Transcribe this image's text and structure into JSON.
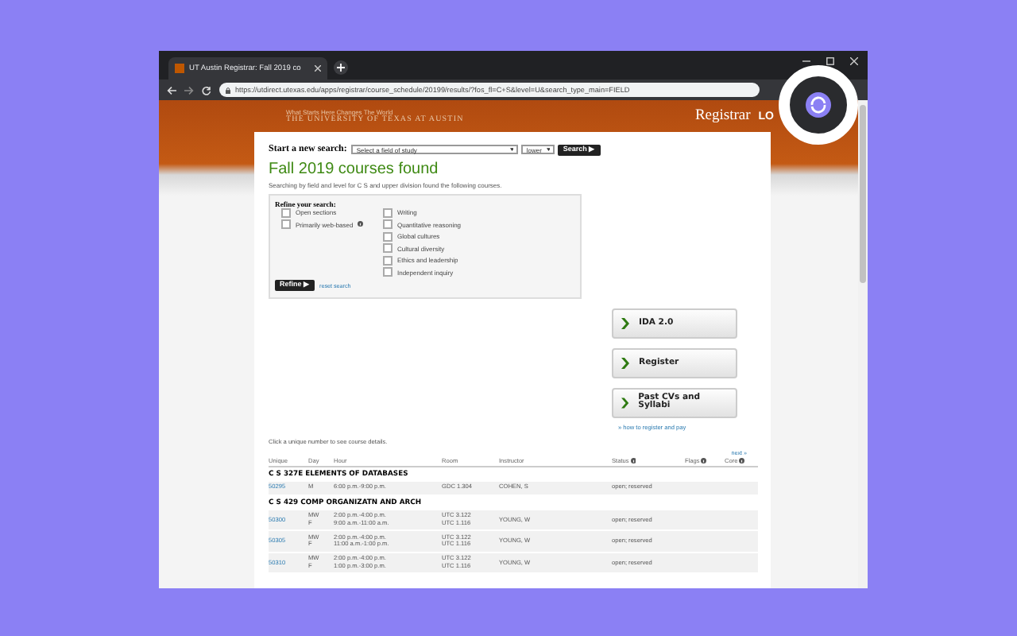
{
  "browser": {
    "tab_title": "UT Austin Registrar: Fall 2019 co",
    "url": "https://utdirect.utexas.edu/apps/registrar/course_schedule/20199/results/?fos_fl=C+S&level=U&search_type_main=FIELD"
  },
  "header": {
    "tagline": "What Starts Here Changes The World",
    "university": "THE UNIVERSITY OF TEXAS AT AUSTIN",
    "registrar": "Registrar",
    "login": "LO"
  },
  "search": {
    "label": "Start a new search:",
    "field": "Select a field of study",
    "level": "lower",
    "button": "Search ▶"
  },
  "heading": "Fall 2019 courses found",
  "summary": "Searching by field and level for C S and upper division found the following courses.",
  "refine": {
    "title": "Refine your search:",
    "left_options": [
      {
        "label": "Open sections",
        "checked": false,
        "info": false
      },
      {
        "label": "Primarily web-based",
        "checked": false,
        "info": true
      }
    ],
    "right_options": [
      {
        "label": "Writing",
        "checked": false
      },
      {
        "label": "Quantitative reasoning",
        "checked": false
      },
      {
        "label": "Global cultures",
        "checked": false
      },
      {
        "label": "Cultural diversity",
        "checked": false
      },
      {
        "label": "Ethics and leadership",
        "checked": false
      },
      {
        "label": "Independent inquiry",
        "checked": false
      }
    ],
    "button": "Refine ▶",
    "reset": "reset search"
  },
  "actions": [
    {
      "label": "IDA 2.0"
    },
    {
      "label": "Register"
    },
    {
      "label": "Past CVs and Syllabi"
    }
  ],
  "register_link": "» how to register and pay",
  "hint": "Click a unique number to see course details.",
  "next": "next »",
  "table": {
    "columns": [
      {
        "label": "Unique",
        "info": false
      },
      {
        "label": "Day",
        "info": false
      },
      {
        "label": "Hour",
        "info": false
      },
      {
        "label": "Room",
        "info": false
      },
      {
        "label": "Instructor",
        "info": false
      },
      {
        "label": "Status",
        "info": true
      },
      {
        "label": "Flags",
        "info": true
      },
      {
        "label": "Core",
        "info": true
      }
    ],
    "groups": [
      {
        "title": "C S 327E ELEMENTS OF DATABASES",
        "rows": [
          {
            "unique": "50295",
            "days": [
              "M"
            ],
            "hours": [
              "6:00 p.m.-9:00 p.m."
            ],
            "rooms": [
              "GDC 1.304"
            ],
            "instructor": "COHEN, S",
            "status": "open; reserved"
          }
        ]
      },
      {
        "title": "C S 429 COMP ORGANIZATN AND ARCH",
        "rows": [
          {
            "unique": "50300",
            "days": [
              "MW",
              "F"
            ],
            "hours": [
              "2:00 p.m.-4:00 p.m.",
              "9:00 a.m.-11:00 a.m."
            ],
            "rooms": [
              "UTC 3.122",
              "UTC 1.116"
            ],
            "instructor": "YOUNG, W",
            "status": "open; reserved"
          },
          {
            "unique": "50305",
            "days": [
              "MW",
              "F"
            ],
            "hours": [
              "2:00 p.m.-4:00 p.m.",
              "11:00 a.m.-1:00 p.m."
            ],
            "rooms": [
              "UTC 3.122",
              "UTC 1.116"
            ],
            "instructor": "YOUNG, W",
            "status": "open; reserved"
          },
          {
            "unique": "50310",
            "days": [
              "MW",
              "F"
            ],
            "hours": [
              "2:00 p.m.-4:00 p.m.",
              "1:00 p.m.-3:00 p.m."
            ],
            "rooms": [
              "UTC 3.122",
              "UTC 1.116"
            ],
            "instructor": "YOUNG, W",
            "status": "open; reserved"
          }
        ]
      }
    ]
  }
}
